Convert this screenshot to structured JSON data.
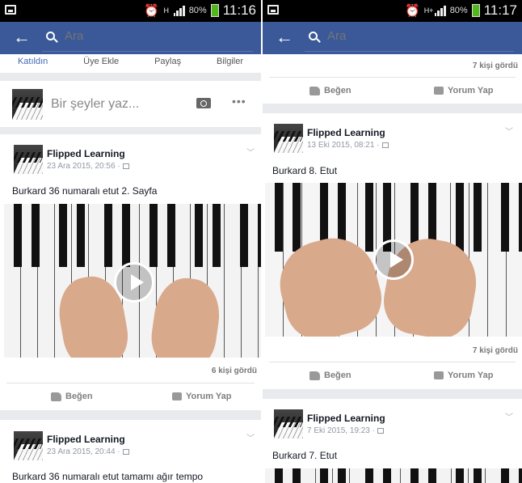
{
  "left": {
    "status": {
      "network": "H",
      "battery": "80%",
      "time": "11:16"
    },
    "search": {
      "placeholder": "Ara"
    },
    "tabs": [
      "Katıldın",
      "Üye Ekle",
      "Paylaş",
      "Bilgiler"
    ],
    "composer": {
      "placeholder": "Bir şeyler yaz..."
    },
    "post1": {
      "author": "Flipped Learning",
      "date": "23 Ara 2015, 20:56 ·",
      "text": "Burkard 36 numaralı etut 2. Sayfa",
      "views": "6 kişi gördü",
      "like": "Beğen",
      "comment": "Yorum Yap"
    },
    "post2": {
      "author": "Flipped Learning",
      "date": "23 Ara 2015, 20:44 ·",
      "text": "Burkard 36 numaralı etut tamamı ağır tempo"
    }
  },
  "right": {
    "status": {
      "network": "H+",
      "battery": "80%",
      "time": "11:17"
    },
    "search": {
      "placeholder": "Ara"
    },
    "top": {
      "views": "7 kişi gördü",
      "like": "Beğen",
      "comment": "Yorum Yap"
    },
    "post1": {
      "author": "Flipped Learning",
      "date": "13 Eki 2015, 08:21 ·",
      "text": "Burkard 8. Etut",
      "views": "7 kişi gördü",
      "like": "Beğen",
      "comment": "Yorum Yap"
    },
    "post2": {
      "author": "Flipped Learning",
      "date": "7 Eki 2015, 19:23 ·",
      "text": "Burkard 7.  Etut"
    }
  },
  "colors": {
    "appbar": "#3b5998",
    "battery": "#52b71c",
    "active_tab": "#4267b2"
  }
}
